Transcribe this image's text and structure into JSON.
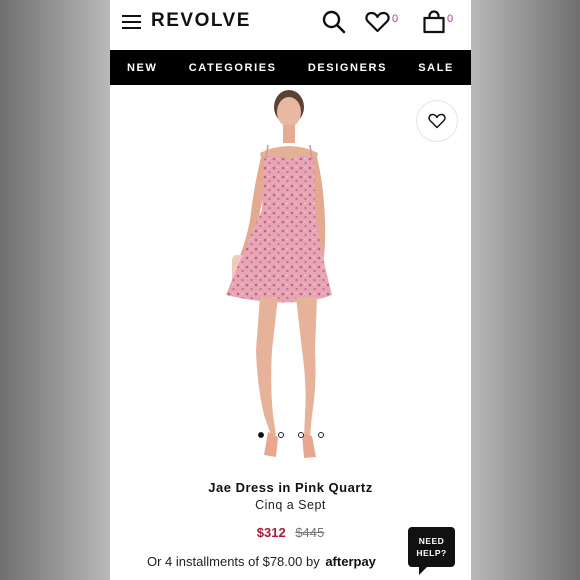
{
  "header": {
    "logo": "REVOLVE",
    "wishlist_count": "0",
    "bag_count": "0",
    "icons": [
      "menu-icon",
      "search-icon",
      "heart-icon",
      "bag-icon"
    ]
  },
  "nav": {
    "items": [
      {
        "label": "NEW"
      },
      {
        "label": "CATEGORIES"
      },
      {
        "label": "DESIGNERS"
      },
      {
        "label": "SALE"
      }
    ]
  },
  "product": {
    "name": "Jae Dress in Pink Quartz",
    "brand": "Cinq a Sept",
    "sale_price": "$312",
    "original_price": "$445",
    "installments_text": "Or 4 installments of $78.00 by",
    "installments_provider": "afterpay",
    "image_count": 4,
    "active_image": 1
  },
  "help": {
    "line1": "NEED",
    "line2": "HELP?"
  },
  "colors": {
    "accent_badge": "#b53a8a",
    "sale_price": "#a2203b",
    "nav_bg": "#000000"
  }
}
